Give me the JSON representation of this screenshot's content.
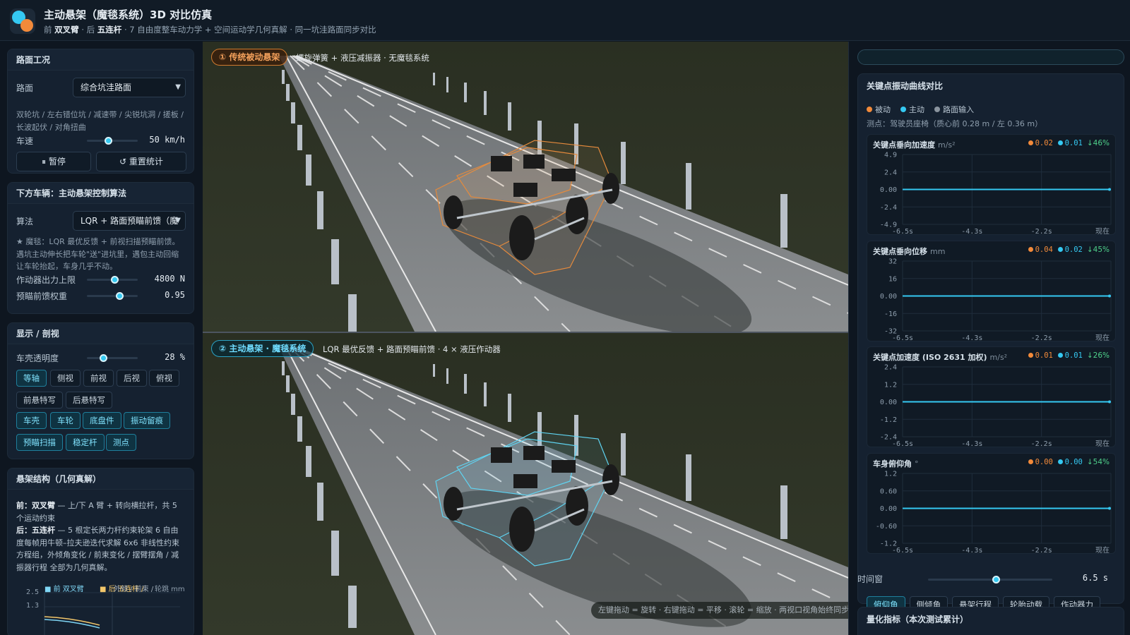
{
  "app": {
    "title": "主动悬架（魔毯系统）3D 对比仿真",
    "subtitle_front_prefix": "前",
    "subtitle_front": "双叉臂",
    "subtitle_rear_prefix": "· 后",
    "subtitle_rear": "五连杆",
    "subtitle_rest": "· 7 自由度整车动力学 + 空间运动学几何真解 · 同一坑洼路面同步对比"
  },
  "road": {
    "title": "路面工况",
    "road_label": "路面",
    "road_value": "综合坑洼路面",
    "description": "双轮坑 / 左右错位坑 / 减速带 / 尖锐坑洞 / 搓板 / 长波起伏 / 对角扭曲",
    "speed_label": "车速",
    "speed_value": "50 km/h",
    "speed_fraction": 0.42,
    "pause_label": "⏸ 暂停",
    "reset_label": "↺ 重置统计"
  },
  "control": {
    "title": "下方车辆：主动悬架控制算法",
    "algo_label": "算法",
    "algo_value": "LQR + 路面预瞄前馈（魔",
    "description": "★ 魔毯：LQR 最优反馈 + 前视扫描预瞄前馈。遇坑主动伸长把车轮\"送\"进坑里，遇包主动回缩让车轮抬起，车身几乎不动。",
    "force_label": "作动器出力上限",
    "force_value": "4800 N",
    "force_fraction": 0.55,
    "ff_label": "预瞄前馈权重",
    "ff_value": "0.95",
    "ff_fraction": 0.65
  },
  "display": {
    "title": "显示 / 剖视",
    "opacity_label": "车壳透明度",
    "opacity_value": "28 %",
    "opacity_fraction": 0.32,
    "views": [
      {
        "label": "等轴",
        "on": true
      },
      {
        "label": "侧视",
        "on": false
      },
      {
        "label": "前视",
        "on": false
      },
      {
        "label": "后视",
        "on": false
      },
      {
        "label": "俯视",
        "on": false
      },
      {
        "label": "前悬特写",
        "on": false
      },
      {
        "label": "后悬特写",
        "on": false
      }
    ],
    "layers": [
      {
        "label": "车壳",
        "on": true
      },
      {
        "label": "车轮",
        "on": true
      },
      {
        "label": "底盘件",
        "on": true
      },
      {
        "label": "振动留痕",
        "on": true
      },
      {
        "label": "预瞄扫描",
        "on": true
      },
      {
        "label": "稳定杆",
        "on": true
      },
      {
        "label": "测点",
        "on": true
      }
    ]
  },
  "structure": {
    "title": "悬架结构（几何真解）",
    "front_label": "前：",
    "front_name": "双叉臂",
    "front_text": "— 上/下 A 臂 + 转向横拉杆，共 5 个运动约束",
    "rear_label": "后：",
    "rear_name": "五连杆",
    "rear_text": "— 5 根定长两力杆约束轮架 6 自由度每帧用牛顿–拉夫逊迭代求解 6x6 非线性约束方程组，外倾角变化 / 前束变化 / 摆臂摆角 / 减振器行程 全部为几何真解。",
    "mini_chart": {
      "legend_front": "■ 前 双叉臂",
      "legend_rear": "■ 后 五连杆 /",
      "legend_extra": "外倾 / 前束 /",
      "unit_label": "轮跳 mm",
      "y_ticks": [
        "2.5",
        "1.3"
      ]
    }
  },
  "viewport_top": {
    "tag": "① 传统被动悬架",
    "desc": "螺旋弹簧 + 液压减振器 · 无魔毯系统"
  },
  "viewport_bottom": {
    "tag": "② 主动悬架 · 魔毯系统",
    "desc": "LQR 最优反馈 + 路面预瞄前馈 · 4 × 液压作动器",
    "hint": "左键拖动 = 旋转 · 右键拖动 = 平移 · 滚轮 = 缩放 · 两视口视角始终同步"
  },
  "curves": {
    "title": "关键点振动曲线对比",
    "legend": [
      "被动",
      "主动",
      "路面输入"
    ],
    "probe": "测点：驾驶员座椅（质心前 0.28 m / 左 0.36 m）",
    "x_ticks": [
      "-6.5s",
      "-4.3s",
      "-2.2s",
      "现在"
    ],
    "charts": [
      {
        "title": "关键点垂向加速度",
        "unit": "m/s²",
        "passive": "0.02",
        "active": "0.01",
        "gain": "↓46%",
        "y_ticks": [
          "4.9",
          "2.4",
          "0.00",
          "-2.4",
          "-4.9"
        ]
      },
      {
        "title": "关键点垂向位移",
        "unit": "mm",
        "passive": "0.04",
        "active": "0.02",
        "gain": "↓45%",
        "y_ticks": [
          "32",
          "16",
          "0.00",
          "-16",
          "-32"
        ]
      },
      {
        "title": "关键点加速度 (ISO 2631 加权)",
        "unit": "m/s²",
        "passive": "0.01",
        "active": "0.01",
        "gain": "↓26%",
        "y_ticks": [
          "2.4",
          "1.2",
          "0.00",
          "-1.2",
          "-2.4"
        ]
      },
      {
        "title": "车身俯仰角",
        "unit": "°",
        "passive": "0.00",
        "active": "0.00",
        "gain": "↓54%",
        "y_ticks": [
          "1.2",
          "0.60",
          "0.00",
          "-0.60",
          "-1.2"
        ]
      }
    ],
    "tabs": [
      {
        "label": "俯仰角",
        "on": true
      },
      {
        "label": "侧倾角",
        "on": false
      },
      {
        "label": "悬架行程",
        "on": false
      },
      {
        "label": "轮胎动载",
        "on": false
      },
      {
        "label": "作动器力",
        "on": false
      }
    ],
    "timewin_label": "时间窗",
    "timewin_value": "6.5 s",
    "timewin_fraction": 0.55
  },
  "metrics": {
    "title": "量化指标（本次测试累计）"
  },
  "colors": {
    "passive": "#f28a3a",
    "active": "#35c9f2",
    "road": "#8a949e",
    "gain": "#4fd18b"
  }
}
